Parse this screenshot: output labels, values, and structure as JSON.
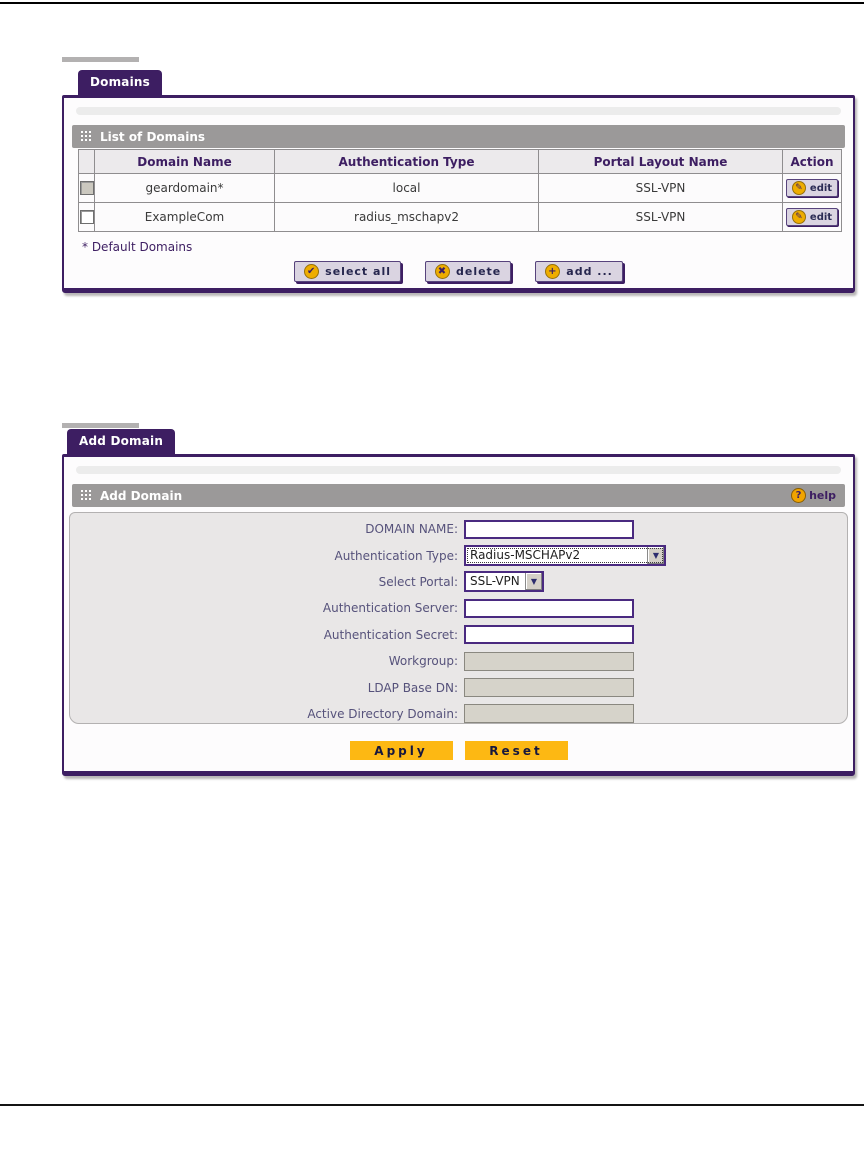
{
  "colors": {
    "accent_purple": "#3d1e62",
    "section_header_gray": "#9b9999",
    "button_lavender": "#dad4e1",
    "gold_button": "#fdb813",
    "disabled_field_bg": "#d6d3ca",
    "yellow_icon": "#eead00"
  },
  "icons": {
    "select_all_glyph": "✔",
    "delete_glyph": "✖",
    "add_glyph": "+",
    "edit_glyph": "✎",
    "help_glyph": "?",
    "dropdown_glyph": "▼"
  },
  "domains": {
    "tab": "Domains",
    "section_title": "List of Domains",
    "table": {
      "headers": [
        "",
        "Domain Name",
        "Authentication Type",
        "Portal Layout Name",
        "Action"
      ],
      "rows": [
        {
          "name": "geardomain*",
          "auth_type": "local",
          "portal": "SSL-VPN",
          "action": "edit",
          "checkbox_state": "disabled"
        },
        {
          "name": "ExampleCom",
          "auth_type": "radius_mschapv2",
          "portal": "SSL-VPN",
          "action": "edit",
          "checkbox_state": "enabled"
        }
      ]
    },
    "footnote": "* Default Domains",
    "buttons": {
      "select_all": "select all",
      "delete": "delete",
      "add": "add ..."
    }
  },
  "add_domain": {
    "tab": "Add Domain",
    "section_title": "Add Domain",
    "help_label": "help",
    "fields": [
      {
        "label": "DOMAIN NAME:",
        "type": "text",
        "value": ""
      },
      {
        "label": "Authentication Type:",
        "type": "select",
        "value": "Radius-MSCHAPv2"
      },
      {
        "label": "Select Portal:",
        "type": "select",
        "value": "SSL-VPN"
      },
      {
        "label": "Authentication Server:",
        "type": "text",
        "value": ""
      },
      {
        "label": "Authentication Secret:",
        "type": "text",
        "value": ""
      },
      {
        "label": "Workgroup:",
        "type": "text_disabled",
        "value": ""
      },
      {
        "label": "LDAP Base DN:",
        "type": "text_disabled",
        "value": ""
      },
      {
        "label": "Active Directory Domain:",
        "type": "text_disabled",
        "value": ""
      }
    ],
    "apply_label": "Apply",
    "reset_label": "Reset"
  }
}
